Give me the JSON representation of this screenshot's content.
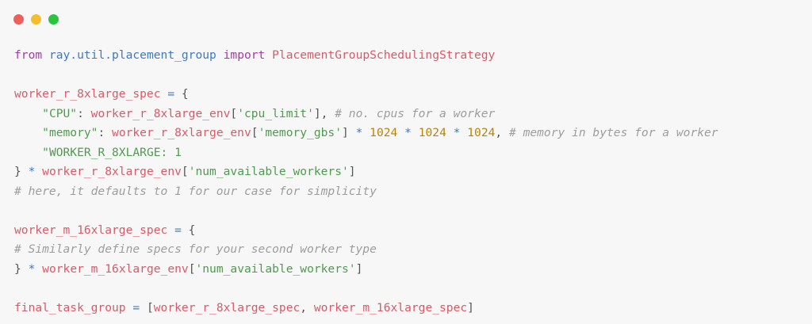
{
  "window": {
    "controls": [
      {
        "name": "close-icon",
        "color": "#ed5f5a"
      },
      {
        "name": "minimize-icon",
        "color": "#f5bd2e"
      },
      {
        "name": "maximize-icon",
        "color": "#2ac53f"
      }
    ]
  },
  "colors": {
    "keyword": "#a33ca5",
    "module": "#3b79c9",
    "variable": "#d85a66",
    "string": "#4f9b4f",
    "number": "#b5850a",
    "comment": "#9d9d9d",
    "background": "#f7f7f7"
  },
  "code": {
    "lines": [
      [
        {
          "t": "kw",
          "v": "from"
        },
        {
          "t": "pl",
          "v": " "
        },
        {
          "t": "mod",
          "v": "ray.util.placement_group"
        },
        {
          "t": "pl",
          "v": " "
        },
        {
          "t": "kw",
          "v": "import"
        },
        {
          "t": "pl",
          "v": " "
        },
        {
          "t": "var",
          "v": "PlacementGroupSchedulingStrategy"
        }
      ],
      [],
      [
        {
          "t": "var",
          "v": "worker_r_8xlarge_spec"
        },
        {
          "t": "pl",
          "v": " "
        },
        {
          "t": "op",
          "v": "="
        },
        {
          "t": "pl",
          "v": " {"
        }
      ],
      [
        {
          "t": "pl",
          "v": "    "
        },
        {
          "t": "str",
          "v": "\"CPU\""
        },
        {
          "t": "pl",
          "v": ": "
        },
        {
          "t": "var",
          "v": "worker_r_8xlarge_env"
        },
        {
          "t": "pl",
          "v": "["
        },
        {
          "t": "str",
          "v": "'cpu_limit'"
        },
        {
          "t": "pl",
          "v": "], "
        },
        {
          "t": "com",
          "v": "# no. cpus for a worker"
        }
      ],
      [
        {
          "t": "pl",
          "v": "    "
        },
        {
          "t": "str",
          "v": "\"memory\""
        },
        {
          "t": "pl",
          "v": ": "
        },
        {
          "t": "var",
          "v": "worker_r_8xlarge_env"
        },
        {
          "t": "pl",
          "v": "["
        },
        {
          "t": "str",
          "v": "'memory_gbs'"
        },
        {
          "t": "pl",
          "v": "] "
        },
        {
          "t": "op",
          "v": "*"
        },
        {
          "t": "pl",
          "v": " "
        },
        {
          "t": "num",
          "v": "1024"
        },
        {
          "t": "pl",
          "v": " "
        },
        {
          "t": "op",
          "v": "*"
        },
        {
          "t": "pl",
          "v": " "
        },
        {
          "t": "num",
          "v": "1024"
        },
        {
          "t": "pl",
          "v": " "
        },
        {
          "t": "op",
          "v": "*"
        },
        {
          "t": "pl",
          "v": " "
        },
        {
          "t": "num",
          "v": "1024"
        },
        {
          "t": "pl",
          "v": ", "
        },
        {
          "t": "com",
          "v": "# memory in bytes for a worker"
        }
      ],
      [
        {
          "t": "pl",
          "v": "    "
        },
        {
          "t": "str",
          "v": "\"WORKER_R_8XLARGE: 1"
        }
      ],
      [
        {
          "t": "pl",
          "v": "} "
        },
        {
          "t": "op",
          "v": "*"
        },
        {
          "t": "pl",
          "v": " "
        },
        {
          "t": "var",
          "v": "worker_r_8xlarge_env"
        },
        {
          "t": "pl",
          "v": "["
        },
        {
          "t": "str",
          "v": "'num_available_workers'"
        },
        {
          "t": "pl",
          "v": "]"
        }
      ],
      [
        {
          "t": "com",
          "v": "# here, it defaults to 1 for our case for simplicity"
        }
      ],
      [],
      [
        {
          "t": "var",
          "v": "worker_m_16xlarge_spec"
        },
        {
          "t": "pl",
          "v": " "
        },
        {
          "t": "op",
          "v": "="
        },
        {
          "t": "pl",
          "v": " {"
        }
      ],
      [
        {
          "t": "com",
          "v": "# Similarly define specs for your second worker type"
        }
      ],
      [
        {
          "t": "pl",
          "v": "} "
        },
        {
          "t": "op",
          "v": "*"
        },
        {
          "t": "pl",
          "v": " "
        },
        {
          "t": "var",
          "v": "worker_m_16xlarge_env"
        },
        {
          "t": "pl",
          "v": "["
        },
        {
          "t": "str",
          "v": "'num_available_workers'"
        },
        {
          "t": "pl",
          "v": "]"
        }
      ],
      [],
      [
        {
          "t": "var",
          "v": "final_task_group"
        },
        {
          "t": "pl",
          "v": " "
        },
        {
          "t": "op",
          "v": "="
        },
        {
          "t": "pl",
          "v": " ["
        },
        {
          "t": "var",
          "v": "worker_r_8xlarge_spec"
        },
        {
          "t": "pl",
          "v": ", "
        },
        {
          "t": "var",
          "v": "worker_m_16xlarge_spec"
        },
        {
          "t": "pl",
          "v": "]"
        }
      ]
    ]
  }
}
